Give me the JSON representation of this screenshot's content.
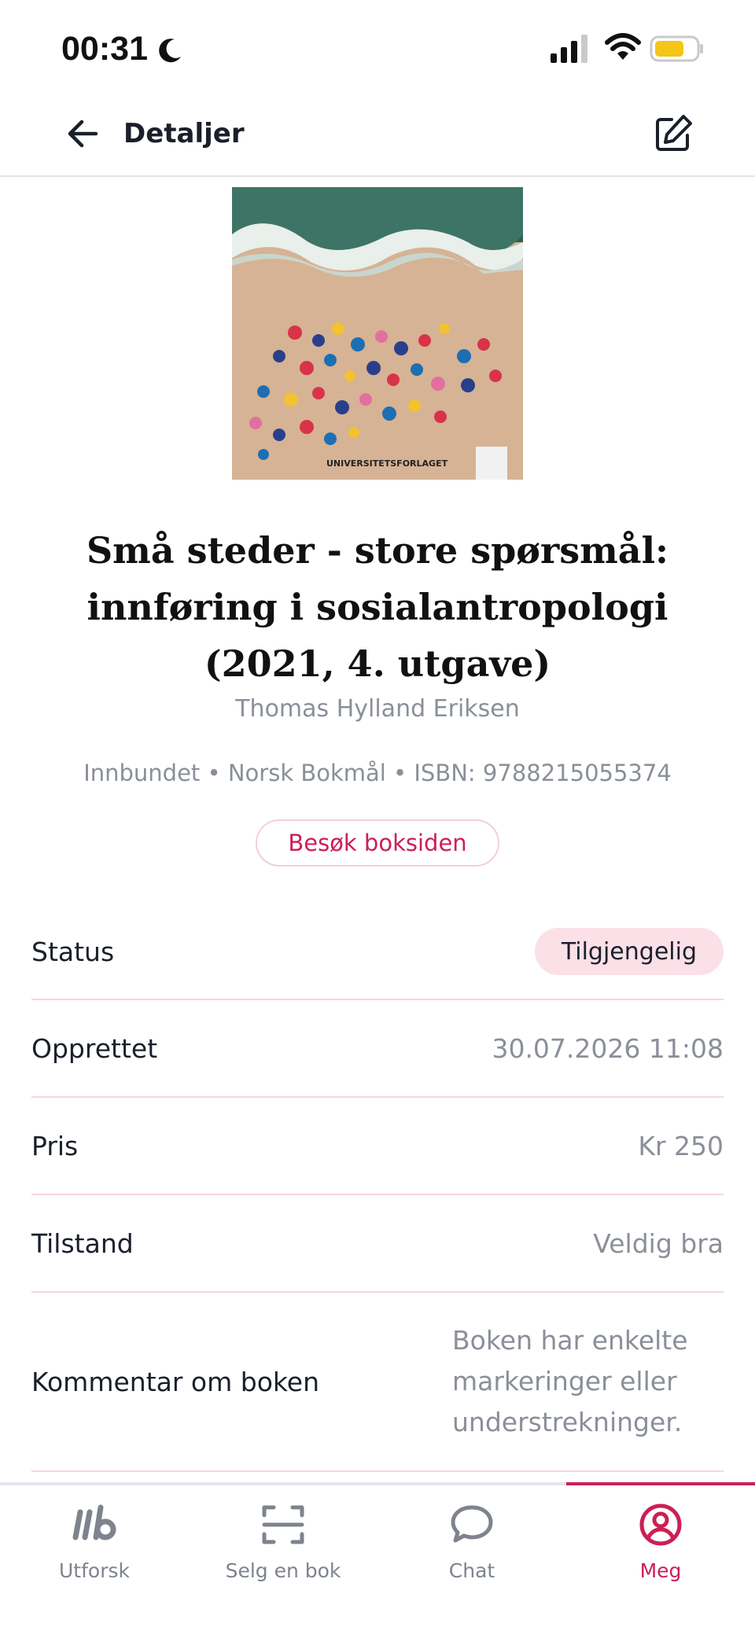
{
  "status_bar": {
    "time": "00:31",
    "icons": [
      "moon-icon",
      "signal-icon",
      "wifi-icon",
      "battery-icon"
    ],
    "battery_color": "#f5c518"
  },
  "header": {
    "title": "Detaljer",
    "back_icon": "arrow-left-icon",
    "edit_icon": "edit-icon"
  },
  "book": {
    "cover_publisher_text": "UNIVERSITETSFORLAGET",
    "title_lines": [
      "Små steder - store spørsmål:",
      "innføring i sosialantropologi",
      "(2021, 4. utgave)"
    ],
    "author": "Thomas Hylland Eriksen",
    "meta": "Innbundet • Norsk Bokmål • ISBN: 9788215055374",
    "visit_button": "Besøk boksiden"
  },
  "details": {
    "status_label": "Status",
    "status_value": "Tilgjengelig",
    "created_label": "Opprettet",
    "created_value": "30.07.2026 11:08",
    "price_label": "Pris",
    "price_value": "Kr 250",
    "condition_label": "Tilstand",
    "condition_value": "Veldig bra",
    "comment_label": "Kommentar om boken",
    "comment_lines": [
      "Boken har enkelte",
      "markeringer eller",
      "understrekninger."
    ]
  },
  "nav": {
    "items": [
      {
        "label": "Utforsk",
        "icon": "logo-icon"
      },
      {
        "label": "Selg en bok",
        "icon": "scan-icon"
      },
      {
        "label": "Chat",
        "icon": "chat-bubble-icon"
      },
      {
        "label": "Meg",
        "icon": "user-circle-icon"
      }
    ],
    "active_index": 3
  },
  "colors": {
    "accent": "#cc1f55",
    "badge_bg": "#fbe0e8",
    "divider": "#f6d7e0",
    "muted_text": "#8a8f99"
  }
}
